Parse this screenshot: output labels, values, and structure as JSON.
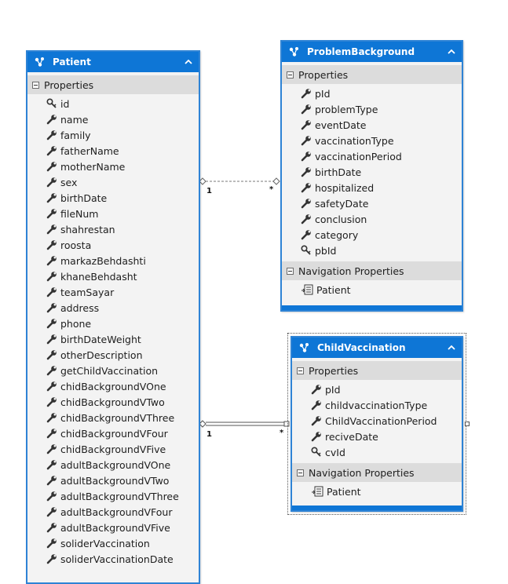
{
  "entities": {
    "patient": {
      "title": "Patient",
      "properties_label": "Properties",
      "properties": [
        {
          "name": "id",
          "key": true
        },
        {
          "name": "name"
        },
        {
          "name": "family"
        },
        {
          "name": "fatherName"
        },
        {
          "name": "motherName"
        },
        {
          "name": "sex"
        },
        {
          "name": "birthDate"
        },
        {
          "name": "fileNum"
        },
        {
          "name": "shahrestan"
        },
        {
          "name": "roosta"
        },
        {
          "name": "markazBehdashti"
        },
        {
          "name": "khaneBehdasht"
        },
        {
          "name": "teamSayar"
        },
        {
          "name": "address"
        },
        {
          "name": "phone"
        },
        {
          "name": "birthDateWeight"
        },
        {
          "name": "otherDescription"
        },
        {
          "name": "getChildVaccination"
        },
        {
          "name": "chidBackgroundVOne"
        },
        {
          "name": "chidBackgroundVTwo"
        },
        {
          "name": "chidBackgroundVThree"
        },
        {
          "name": "chidBackgroundVFour"
        },
        {
          "name": "chidBackgroundVFive"
        },
        {
          "name": "adultBackgroundVOne"
        },
        {
          "name": "adultBackgroundVTwo"
        },
        {
          "name": "adultBackgroundVThree"
        },
        {
          "name": "adultBackgroundVFour"
        },
        {
          "name": "adultBackgroundVFive"
        },
        {
          "name": "soliderVaccination"
        },
        {
          "name": "soliderVaccinationDate"
        }
      ]
    },
    "problemBackground": {
      "title": "ProblemBackground",
      "properties_label": "Properties",
      "properties": [
        {
          "name": "pId"
        },
        {
          "name": "problemType"
        },
        {
          "name": "eventDate"
        },
        {
          "name": "vaccinationType"
        },
        {
          "name": "vaccinationPeriod"
        },
        {
          "name": "birthDate"
        },
        {
          "name": "hospitalized"
        },
        {
          "name": "safetyDate"
        },
        {
          "name": "conclusion"
        },
        {
          "name": "category"
        },
        {
          "name": "pbId",
          "key": true
        }
      ],
      "navigation_label": "Navigation Properties",
      "navigation": [
        "Patient"
      ]
    },
    "childVaccination": {
      "title": "ChildVaccination",
      "properties_label": "Properties",
      "properties": [
        {
          "name": "pId"
        },
        {
          "name": "childvaccinationType"
        },
        {
          "name": "ChildVaccinationPeriod"
        },
        {
          "name": "reciveDate"
        },
        {
          "name": "cvId",
          "key": true
        }
      ],
      "navigation_label": "Navigation Properties",
      "navigation": [
        "Patient"
      ]
    }
  },
  "associations": [
    {
      "from": "Patient",
      "to": "ProblemBackground",
      "from_multiplicity": "1",
      "to_multiplicity": "*"
    },
    {
      "from": "Patient",
      "to": "ChildVaccination",
      "from_multiplicity": "1",
      "to_multiplicity": "*"
    }
  ],
  "colors": {
    "header": "#0e76d6",
    "border": "#2e83d5",
    "body": "#f3f3f3",
    "section": "#dcdcdc"
  }
}
